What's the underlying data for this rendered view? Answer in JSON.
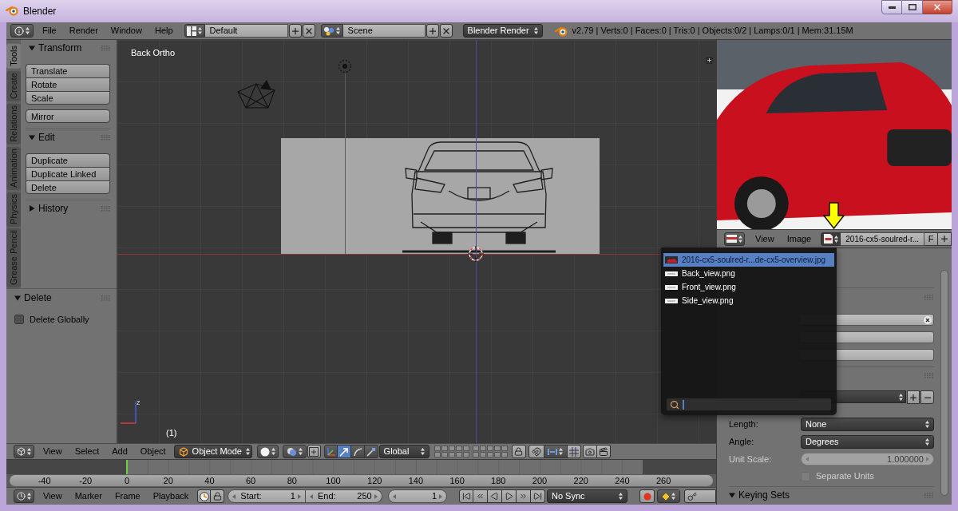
{
  "window": {
    "title": "Blender"
  },
  "info_header": {
    "menus": [
      "File",
      "Render",
      "Window",
      "Help"
    ],
    "screen_layout": "Default",
    "scene": "Scene",
    "render_engine": "Blender Render",
    "stats": "v2.79 | Verts:0 | Faces:0 | Tris:0 | Objects:0/2 | Lamps:0/1 | Mem:31.15M"
  },
  "tool_shelf": {
    "tabs": [
      {
        "label": "Tools",
        "selected": true
      },
      {
        "label": "Create",
        "selected": false
      },
      {
        "label": "Relations",
        "selected": false
      },
      {
        "label": "Animation",
        "selected": false
      },
      {
        "label": "Physics",
        "selected": false
      },
      {
        "label": "Grease Pencil",
        "selected": false
      }
    ],
    "panels": [
      {
        "title": "Transform",
        "expanded": true,
        "groups": [
          [
            "Translate",
            "Rotate",
            "Scale"
          ],
          [
            "Mirror"
          ]
        ]
      },
      {
        "title": "Edit",
        "expanded": true,
        "groups": [
          [
            "Duplicate",
            "Duplicate Linked",
            "Delete"
          ]
        ]
      },
      {
        "title": "History",
        "expanded": false
      }
    ]
  },
  "operator_panel": {
    "title": "Delete",
    "expanded": true,
    "options": [
      {
        "label": "Delete Globally",
        "checked": false
      }
    ]
  },
  "viewport": {
    "view_name": "Back Ortho",
    "frame_label": "(1)",
    "axis_label": "z"
  },
  "viewport_header": {
    "menus": [
      "View",
      "Select",
      "Add",
      "Object"
    ],
    "mode": "Object Mode",
    "manipulators": [
      {
        "selected": false
      },
      {
        "selected": true
      },
      {
        "selected": false
      },
      {
        "selected": false
      }
    ],
    "orientation": "Global"
  },
  "timeline": {
    "ticks": [
      "-40",
      "-20",
      "0",
      "20",
      "40",
      "60",
      "80",
      "100",
      "120",
      "140",
      "160",
      "180",
      "200",
      "220",
      "240",
      "260"
    ]
  },
  "timeline_header": {
    "menus": [
      "View",
      "Marker",
      "Frame",
      "Playback"
    ],
    "start": {
      "label": "Start:",
      "value": "1"
    },
    "end": {
      "label": "End:",
      "value": "250"
    },
    "current_frame": "1",
    "sync": "No Sync"
  },
  "image_editor": {
    "menus": [
      "View",
      "Image"
    ],
    "image_name": "2016-cx5-soulred-r...",
    "fake_user": "F"
  },
  "image_menu": {
    "open": true,
    "items": [
      {
        "label": "2016-cx5-soulred-r...de-cx5-overview.jpg",
        "kind": "photo",
        "selected": true
      },
      {
        "label": "Back_view.png",
        "kind": "sketch",
        "selected": false
      },
      {
        "label": "Front_view.png",
        "kind": "sketch",
        "selected": false
      },
      {
        "label": "Side_view.png",
        "kind": "sketch",
        "selected": false
      }
    ]
  },
  "properties": {
    "rows": [
      {
        "kind": "menu",
        "label": "Length:",
        "value": "None"
      },
      {
        "kind": "menu",
        "label": "Angle:",
        "value": "Degrees"
      },
      {
        "kind": "number",
        "label": "Unit Scale:",
        "value": "1.000000",
        "disabled": true
      },
      {
        "kind": "checkbox",
        "label": "Separate Units",
        "checked": false,
        "disabled": true
      }
    ],
    "sections": [
      {
        "title": "Keying Sets",
        "expanded": true
      }
    ]
  }
}
